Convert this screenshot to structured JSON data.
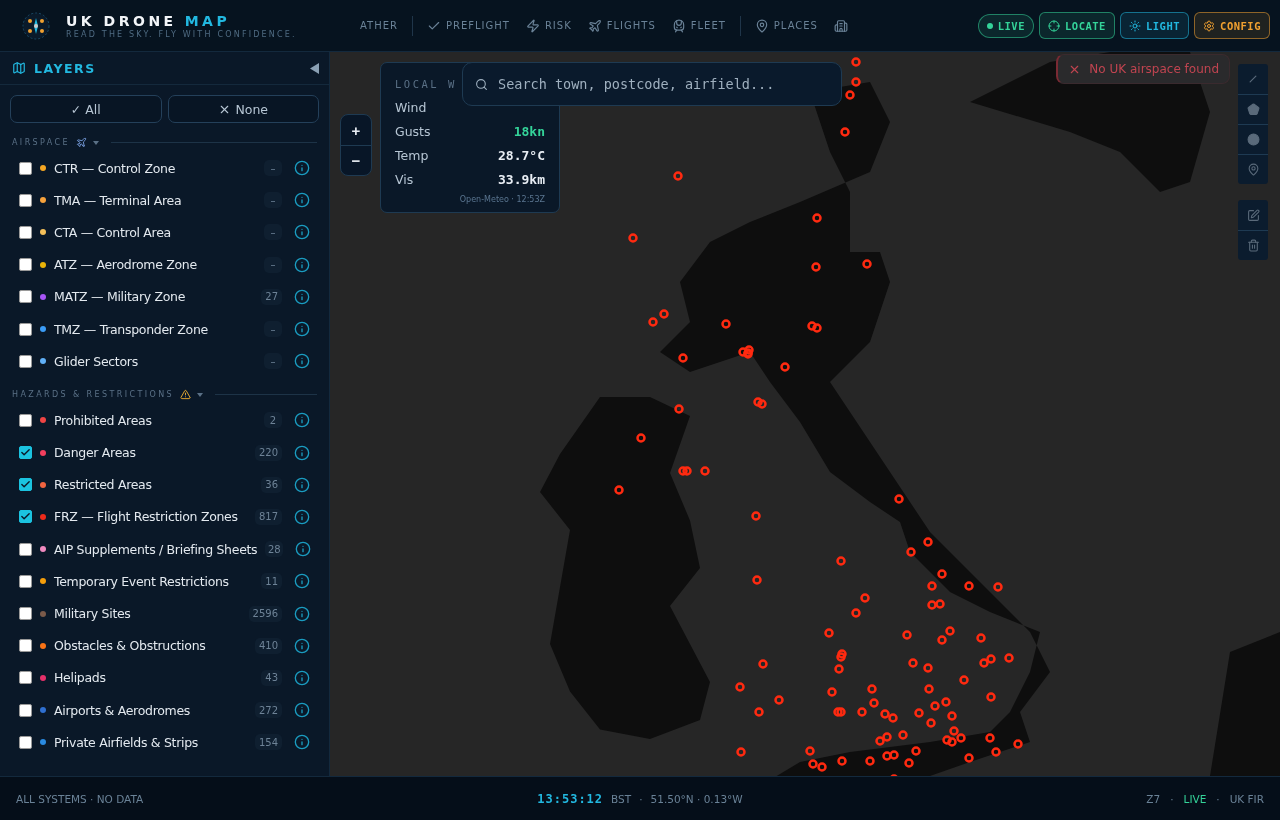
{
  "header": {
    "title": "UK DRONE",
    "title_accent": "MAP",
    "tagline": "READ THE SKY. FLY WITH CONFIDENCE.",
    "nav": [
      {
        "label": "ATHER"
      },
      {
        "label": "PREFLIGHT"
      },
      {
        "label": "RISK"
      },
      {
        "label": "FLIGHTS"
      },
      {
        "label": "FLEET"
      },
      {
        "label": "PLACES"
      }
    ],
    "actions": [
      {
        "kind": "status",
        "label": "LIVE",
        "color": "#34d399"
      },
      {
        "kind": "button",
        "label": "LOCATE",
        "color": "#34d399"
      },
      {
        "kind": "button",
        "label": "LIGHT",
        "color": "#22b8e0"
      },
      {
        "kind": "button",
        "label": "CONFIG",
        "color": "#f0a030"
      }
    ]
  },
  "sidebar": {
    "title": "LAYERS",
    "buttons": [
      "✓ All",
      "None"
    ],
    "sections": [
      {
        "title": "AIRSPACE",
        "items": [
          {
            "label": "CTR — Control Zone",
            "color": "#f5a623",
            "count": "–",
            "checked": false
          },
          {
            "label": "TMA — Terminal Area",
            "color": "#f7a23c",
            "count": "–",
            "checked": false
          },
          {
            "label": "CTA — Control Area",
            "color": "#f5c05a",
            "count": "–",
            "checked": false
          },
          {
            "label": "ATZ — Aerodrome Zone",
            "color": "#eab308",
            "count": "–",
            "checked": false
          },
          {
            "label": "MATZ — Military Zone",
            "color": "#a855f7",
            "count": "27",
            "checked": false
          },
          {
            "label": "TMZ — Transponder Zone",
            "color": "#3b9cf6",
            "count": "–",
            "checked": false
          },
          {
            "label": "Glider Sectors",
            "color": "#60b0f8",
            "count": "–",
            "checked": false
          }
        ]
      },
      {
        "title": "HAZARDS & RESTRICTIONS",
        "items": [
          {
            "label": "Prohibited Areas",
            "color": "#ef4444",
            "count": "2",
            "checked": false
          },
          {
            "label": "Danger Areas",
            "color": "#f43f5e",
            "count": "220",
            "checked": true
          },
          {
            "label": "Restricted Areas",
            "color": "#f26440",
            "count": "36",
            "checked": true
          },
          {
            "label": "FRZ — Flight Restriction Zones",
            "color": "#ee2a1a",
            "count": "817",
            "checked": true
          },
          {
            "label": "AIP Supplements / Briefing Sheets",
            "color": "#f08ac0",
            "count": "28",
            "checked": false
          },
          {
            "label": "Temporary Event Restrictions",
            "color": "#f59e0b",
            "count": "11",
            "checked": false
          },
          {
            "label": "Military Sites",
            "color": "#7a5a4a",
            "count": "2596",
            "checked": false
          },
          {
            "label": "Obstacles & Obstructions",
            "color": "#f97316",
            "count": "410",
            "checked": false
          },
          {
            "label": "Helipads",
            "color": "#e5306a",
            "count": "43",
            "checked": false
          },
          {
            "label": "Airports & Aerodromes",
            "color": "#2f6fd0",
            "count": "272",
            "checked": false
          },
          {
            "label": "Private Airfields & Strips",
            "color": "#2a8ae0",
            "count": "154",
            "checked": false
          }
        ]
      }
    ]
  },
  "map": {
    "zoom": [
      "+",
      "−"
    ],
    "weather": {
      "title": "LOCAL W",
      "rows": [
        {
          "label": "Wind"
        },
        {
          "label": "Gusts",
          "value": "18kn",
          "color": "#34d399"
        },
        {
          "label": "Temp",
          "value": "28.7°C",
          "color": "#e8edf3"
        },
        {
          "label": "Vis",
          "value": "33.9km",
          "color": "#e8edf3"
        }
      ],
      "credit": "Open-Meteo · 12:53Z"
    },
    "search": {
      "placeholder": "Search town, postcode, airfield..."
    },
    "toast": "No UK airspace found"
  },
  "status_bar": {
    "left": "ALL SYSTEMS · NO DATA",
    "time": "13:53:12",
    "zone": "BST",
    "separator": "·",
    "coords": "51.50°N · 0.13°W",
    "zoom": "Z7",
    "live": "LIVE",
    "region": "UK FIR"
  }
}
